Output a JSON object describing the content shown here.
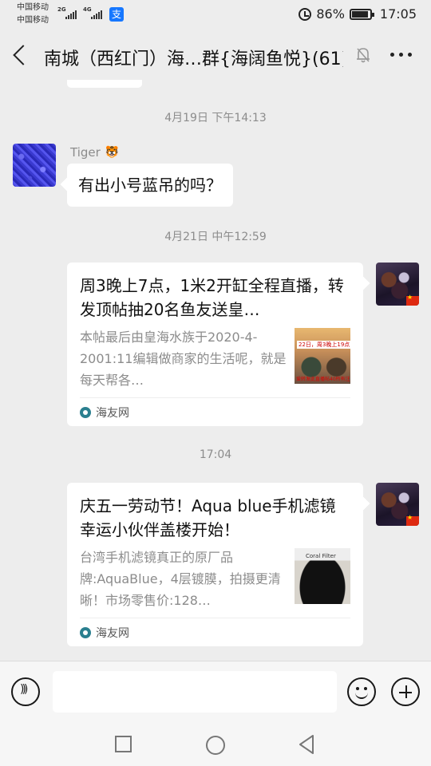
{
  "status_bar": {
    "carrier1": "中国移动",
    "carrier2": "中国移动",
    "net1": "2G",
    "net2": "4G",
    "battery": "86%",
    "time": "17:05",
    "app_icon": "支"
  },
  "header": {
    "title": "南城（西红门）海…群{海阔鱼悦}(61)",
    "icons": [
      "back-icon",
      "mute-icon",
      "more-icon"
    ]
  },
  "messages": {
    "time1": "4月19日 下午14:13",
    "sender": "Tiger",
    "text1": "有出小号蓝吊的吗？",
    "time2": "4月21日 中午12:59",
    "card1": {
      "title": "周3晚上7点，1米2开缸全程直播，转发顶帖抽20名鱼友送皇…",
      "desc": "本帖最后由皇海水族于2020-4-2001:11编辑做商家的生活呢，就是每天帮各…",
      "thumb_tag": "22日，周3晚上19点",
      "thumb_tag2": "爱转发此直播帖40所有注意!",
      "source": "海友网"
    },
    "time3": "17:04",
    "card2": {
      "title": "庆五一劳动节！Aqua blue手机滤镜幸运小伙伴盖楼开始！",
      "desc": "台湾手机滤镜真正的原厂品牌:AquaBlue，4层镀膜，拍摄更清晰！市场零售价:128…",
      "thumb_tag": "Coral Filter",
      "source": "海友网"
    }
  },
  "colors": {
    "background": "#ededed",
    "bubble": "#ffffff",
    "meta_text": "#8c8c8c"
  }
}
